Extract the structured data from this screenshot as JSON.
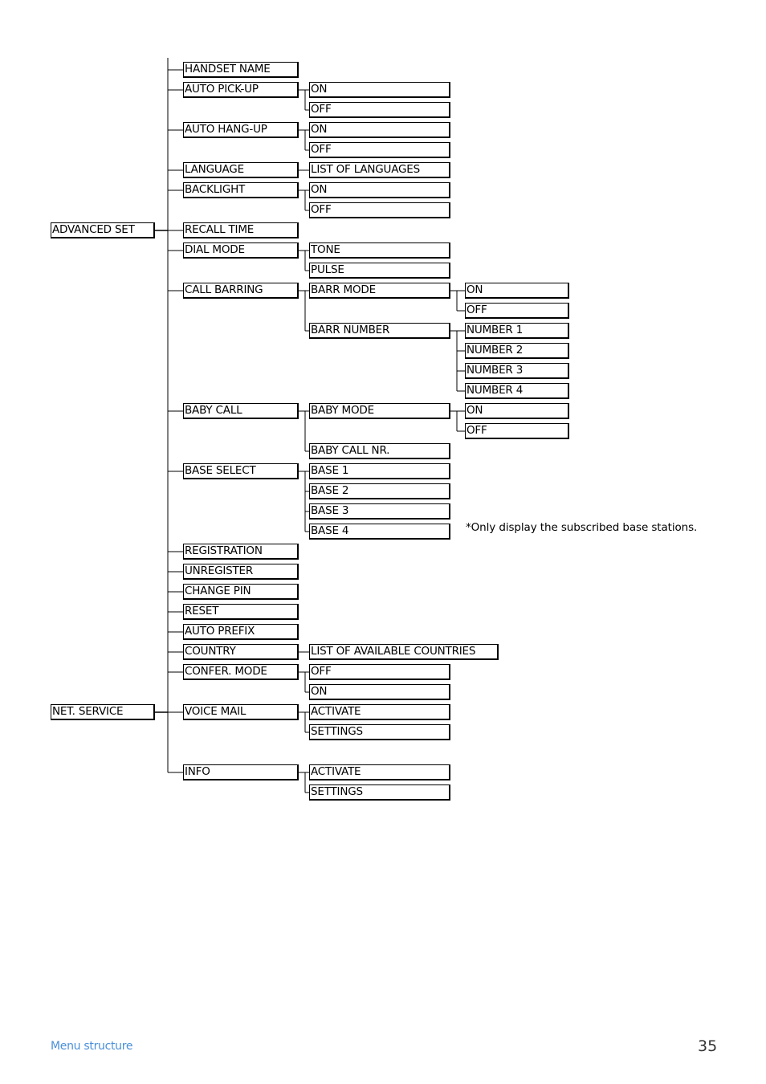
{
  "menu_tree": [
    {
      "label": "ADVANCED SET",
      "row": 8,
      "children": [
        {
          "label": "HANDSET NAME",
          "row": 0
        },
        {
          "label": "AUTO PICK-UP",
          "row": 1,
          "children": [
            {
              "label": "ON",
              "row": 1
            },
            {
              "label": "OFF",
              "row": 2
            }
          ]
        },
        {
          "label": "AUTO HANG-UP",
          "row": 3,
          "children": [
            {
              "label": "ON",
              "row": 3
            },
            {
              "label": "OFF",
              "row": 4
            }
          ]
        },
        {
          "label": "LANGUAGE",
          "row": 5,
          "children": [
            {
              "label": "LIST OF LANGUAGES",
              "row": 5
            }
          ]
        },
        {
          "label": "BACKLIGHT",
          "row": 6,
          "children": [
            {
              "label": "ON",
              "row": 6
            },
            {
              "label": "OFF",
              "row": 7
            }
          ]
        },
        {
          "label": "RECALL TIME",
          "row": 8
        },
        {
          "label": "DIAL MODE",
          "row": 9,
          "children": [
            {
              "label": "TONE",
              "row": 9
            },
            {
              "label": "PULSE",
              "row": 10
            }
          ]
        },
        {
          "label": "CALL BARRING",
          "row": 11,
          "children": [
            {
              "label": "BARR MODE",
              "row": 11,
              "children": [
                {
                  "label": "ON",
                  "row": 11
                },
                {
                  "label": "OFF",
                  "row": 12
                }
              ]
            },
            {
              "label": "BARR NUMBER",
              "row": 13,
              "children": [
                {
                  "label": "NUMBER 1",
                  "row": 13
                },
                {
                  "label": "NUMBER 2",
                  "row": 14
                },
                {
                  "label": "NUMBER 3",
                  "row": 15
                },
                {
                  "label": "NUMBER 4",
                  "row": 16
                }
              ]
            }
          ]
        },
        {
          "label": "BABY CALL",
          "row": 17,
          "children": [
            {
              "label": "BABY MODE",
              "row": 17,
              "children": [
                {
                  "label": "ON",
                  "row": 17
                },
                {
                  "label": "OFF",
                  "row": 18
                }
              ]
            },
            {
              "label": "BABY CALL NR.",
              "row": 19
            }
          ]
        },
        {
          "label": "BASE SELECT",
          "row": 20,
          "children": [
            {
              "label": "BASE 1",
              "row": 20
            },
            {
              "label": "BASE 2",
              "row": 21
            },
            {
              "label": "BASE 3",
              "row": 22
            },
            {
              "label": "BASE 4",
              "row": 23
            }
          ]
        },
        {
          "label": "REGISTRATION",
          "row": 24
        },
        {
          "label": "UNREGISTER",
          "row": 25
        },
        {
          "label": "CHANGE PIN",
          "row": 26
        },
        {
          "label": "RESET",
          "row": 27
        },
        {
          "label": "AUTO PREFIX",
          "row": 28
        },
        {
          "label": "COUNTRY",
          "row": 29,
          "children": [
            {
              "label": "LIST OF AVAILABLE COUNTRIES",
              "row": 29,
              "wide": true
            }
          ]
        },
        {
          "label": "CONFER. MODE",
          "row": 30,
          "children": [
            {
              "label": "OFF",
              "row": 30
            },
            {
              "label": "ON",
              "row": 31
            }
          ]
        }
      ]
    },
    {
      "label": "NET. SERVICE",
      "row": 32,
      "children": [
        {
          "label": "VOICE MAIL",
          "row": 32,
          "children": [
            {
              "label": "ACTIVATE",
              "row": 32
            },
            {
              "label": "SETTINGS",
              "row": 33
            }
          ]
        },
        {
          "label": "INFO",
          "row": 35,
          "children": [
            {
              "label": "ACTIVATE",
              "row": 35
            },
            {
              "label": "SETTINGS",
              "row": 36
            }
          ]
        }
      ]
    }
  ],
  "base_note": "*Only display the subscribed base stations.",
  "footer": {
    "section_title": "Menu structure",
    "page_number": "35",
    "section_color": "#4a90d9"
  }
}
